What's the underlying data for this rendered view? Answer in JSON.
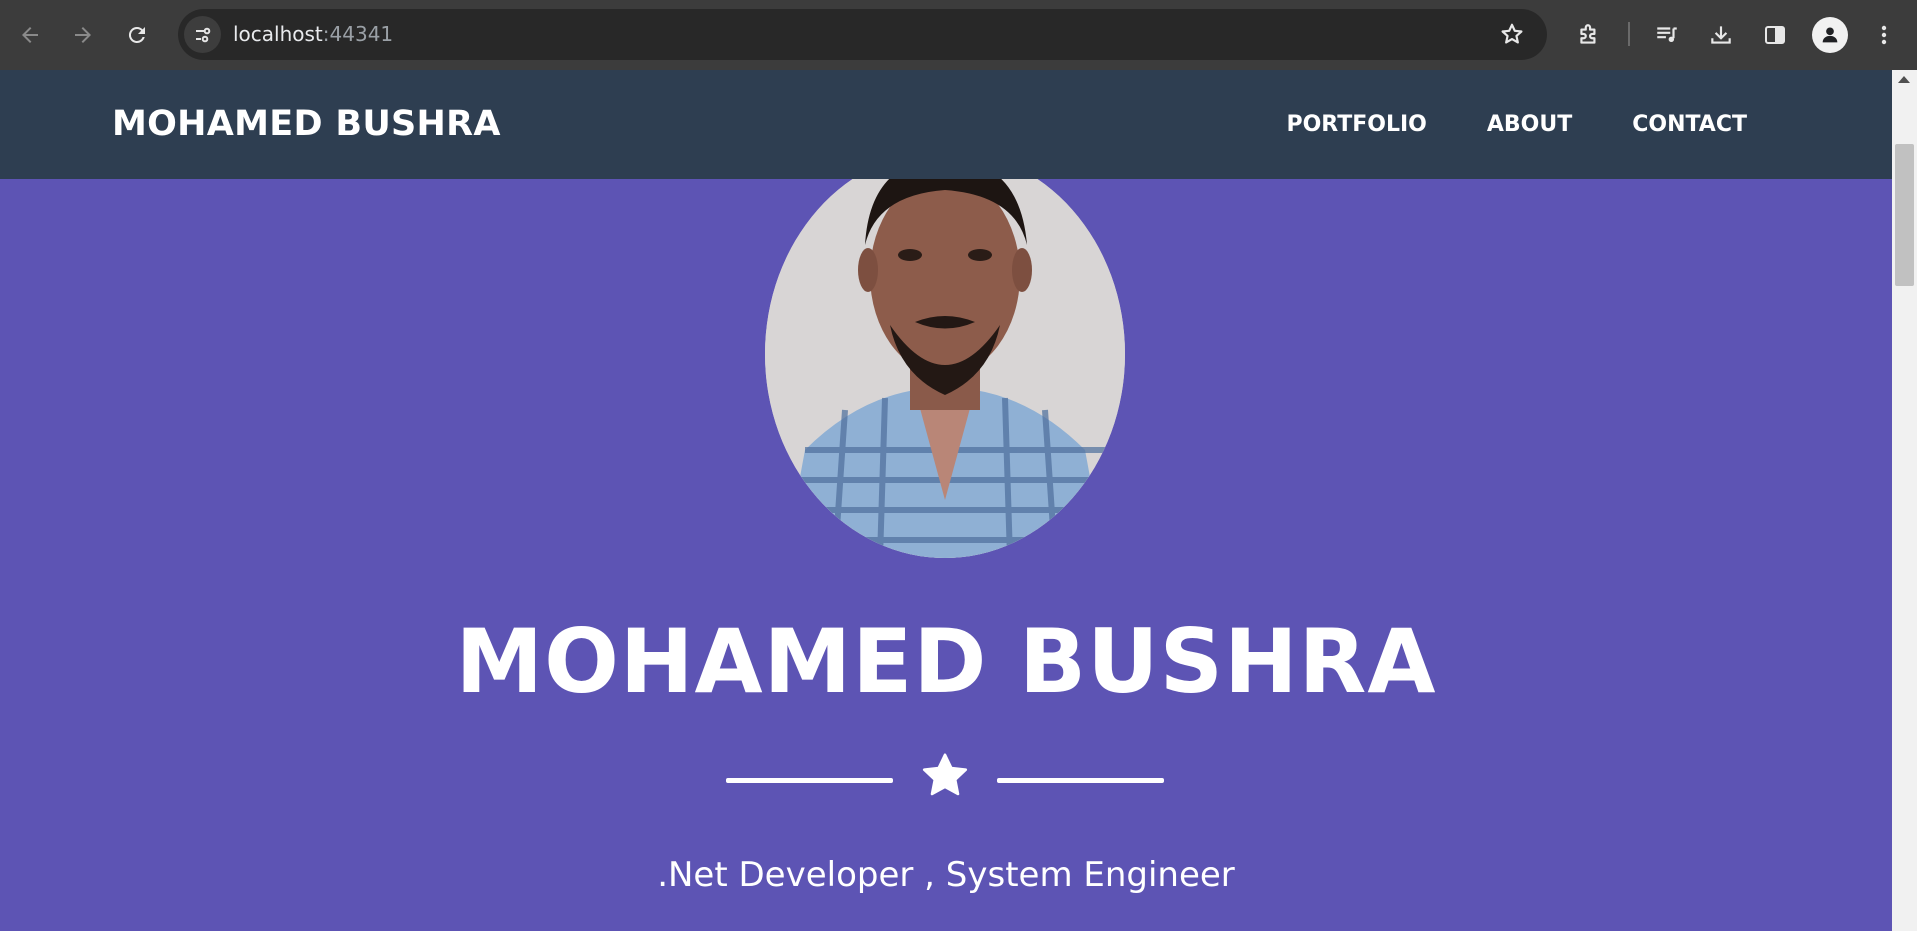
{
  "browser": {
    "url_host": "localhost",
    "url_port": ":44341",
    "icons": [
      "back-arrow-icon",
      "forward-arrow-icon",
      "reload-icon",
      "site-info-icon",
      "star-bookmark-icon",
      "extensions-icon",
      "media-queue-icon",
      "download-icon",
      "side-panel-icon",
      "profile-icon",
      "more-menu-icon"
    ]
  },
  "navbar": {
    "brand": "MOHAMED BUSHRA",
    "links": [
      "PORTFOLIO",
      "ABOUT",
      "CONTACT"
    ]
  },
  "hero": {
    "name": "MOHAMED BUSHRA",
    "subtitle": ".Net Developer , System Engineer",
    "photo_alt": "profile photo"
  },
  "colors": {
    "hero_bg": "#5d54b4",
    "navbar_bg": "#2e3e51",
    "text": "#ffffff"
  }
}
